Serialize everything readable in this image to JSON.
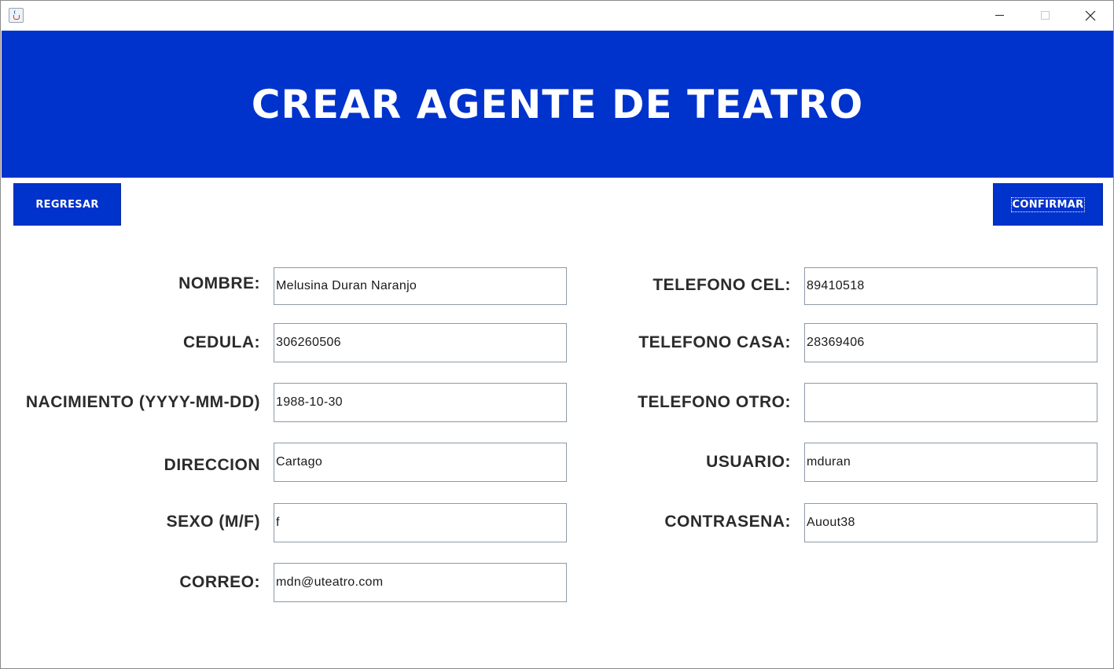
{
  "window": {
    "icon": "java-cup-icon",
    "controls": {
      "minimize": "minimize-icon",
      "maximize": "maximize-icon",
      "close": "close-icon"
    }
  },
  "header": {
    "title": "CREAR AGENTE DE TEATRO"
  },
  "buttons": {
    "back": "REGRESAR",
    "confirm": "CONFIRMAR"
  },
  "colors": {
    "accent": "#0032cc",
    "label": "#2b2b2b",
    "input_border": "#8c9aa8"
  },
  "form": {
    "nombre": {
      "label": "NOMBRE:",
      "value": "Melusina Duran Naranjo"
    },
    "cedula": {
      "label": "CEDULA:",
      "value": "306260506"
    },
    "nacimiento": {
      "label": "NACIMIENTO (YYYY-MM-DD)",
      "value": "1988-10-30"
    },
    "direccion": {
      "label": "DIRECCION",
      "value": "Cartago"
    },
    "sexo": {
      "label": "SEXO (M/F)",
      "value": "f"
    },
    "correo": {
      "label": "CORREO:",
      "value": "mdn@uteatro.com"
    },
    "telefono_cel": {
      "label": "TELEFONO CEL:",
      "value": "89410518"
    },
    "telefono_casa": {
      "label": "TELEFONO CASA:",
      "value": "28369406"
    },
    "telefono_otro": {
      "label": "TELEFONO OTRO:",
      "value": ""
    },
    "usuario": {
      "label": "USUARIO:",
      "value": "mduran"
    },
    "contrasena": {
      "label": "CONTRASENA:",
      "value": "Auout38"
    }
  }
}
